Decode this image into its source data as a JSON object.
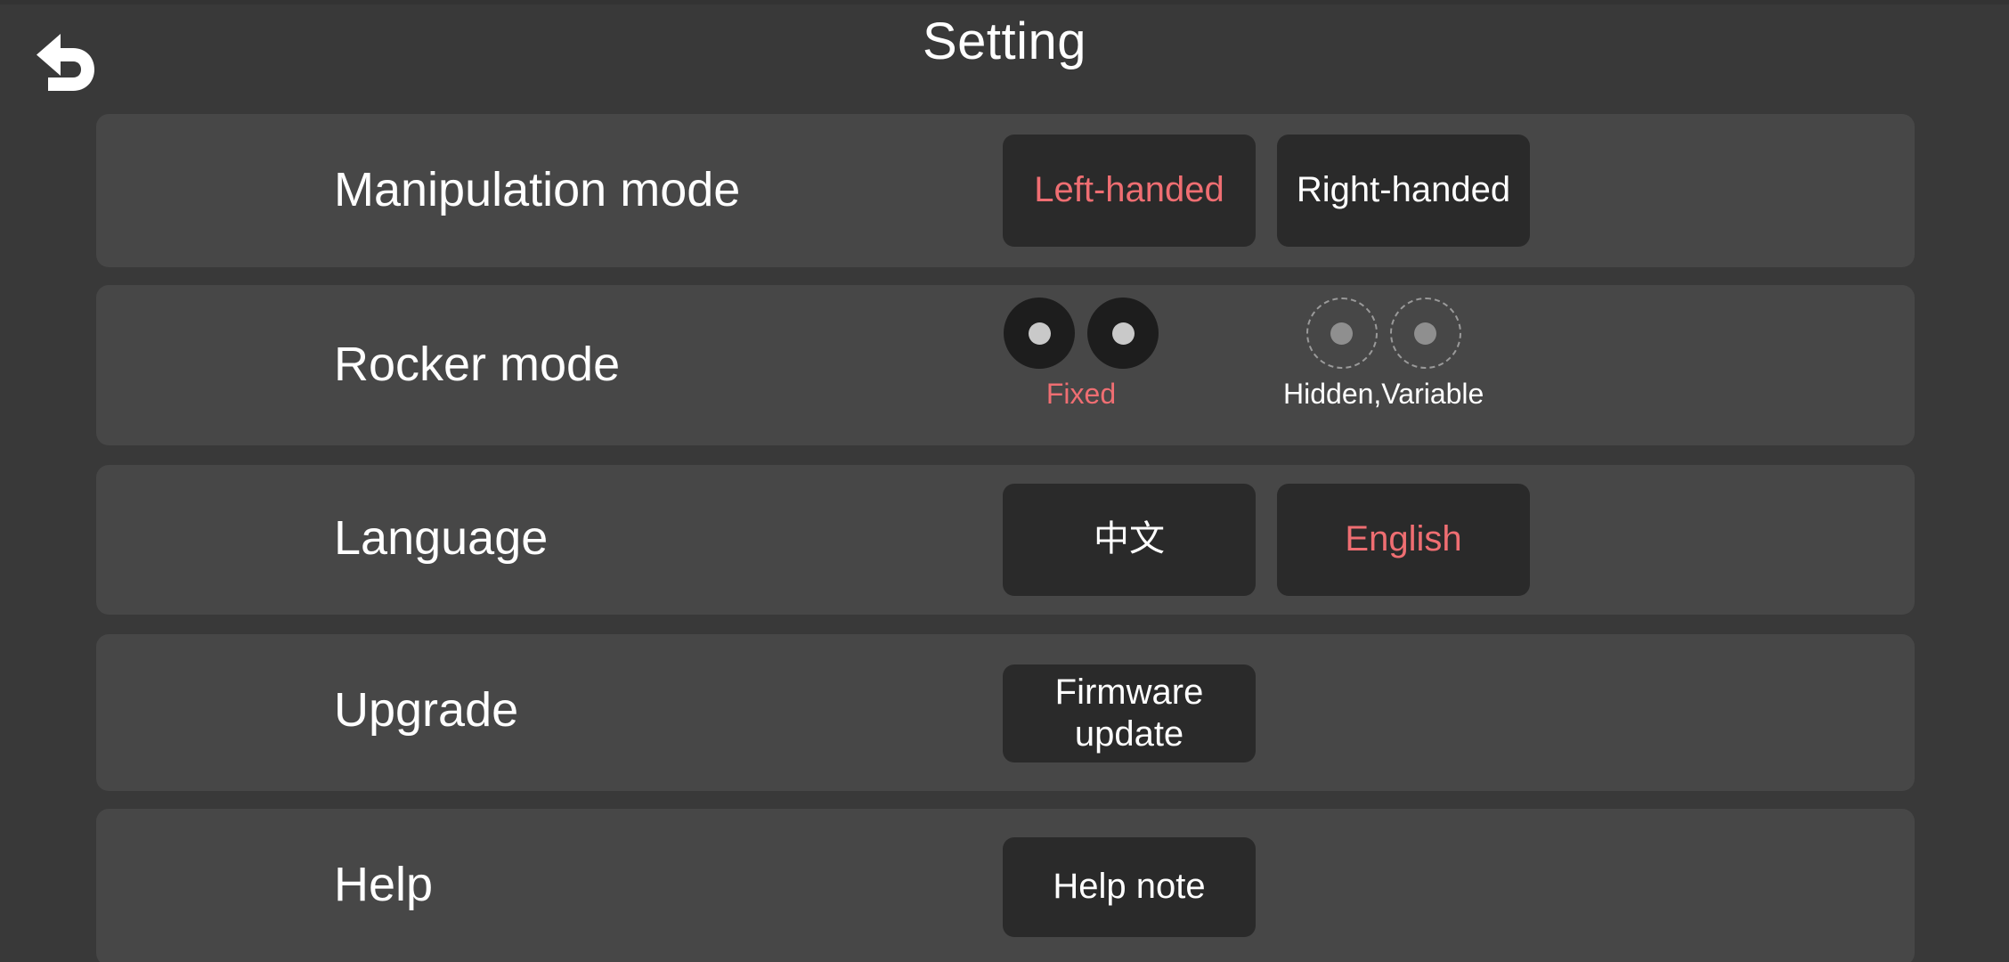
{
  "header": {
    "title": "Setting",
    "back_icon": "undo-arrow-icon"
  },
  "colors": {
    "page_background": "#393939",
    "row_background": "#474747",
    "button_background": "#2a2a2a",
    "accent_selected": "#ef6e72",
    "text_primary": "#ffffff",
    "stick_dot": "#c9c9c9"
  },
  "rows": [
    {
      "key": "manipulation-mode",
      "label": "Manipulation mode",
      "options": [
        {
          "label": "Left-handed",
          "selected": true
        },
        {
          "label": "Right-handed",
          "selected": false
        }
      ]
    },
    {
      "key": "rocker-mode",
      "label": "Rocker mode",
      "options": [
        {
          "label": "Fixed",
          "selected": true,
          "style": "solid"
        },
        {
          "label": "Hidden,Variable",
          "selected": false,
          "style": "dashed"
        }
      ]
    },
    {
      "key": "language",
      "label": "Language",
      "options": [
        {
          "label": "中文",
          "selected": false
        },
        {
          "label": "English",
          "selected": true
        }
      ]
    },
    {
      "key": "upgrade",
      "label": "Upgrade",
      "options": [
        {
          "label": "Firmware\nupdate",
          "line1": "Firmware",
          "line2": "update",
          "selected": false
        }
      ]
    },
    {
      "key": "help",
      "label": "Help",
      "options": [
        {
          "label": "Help note",
          "selected": false
        }
      ]
    }
  ]
}
